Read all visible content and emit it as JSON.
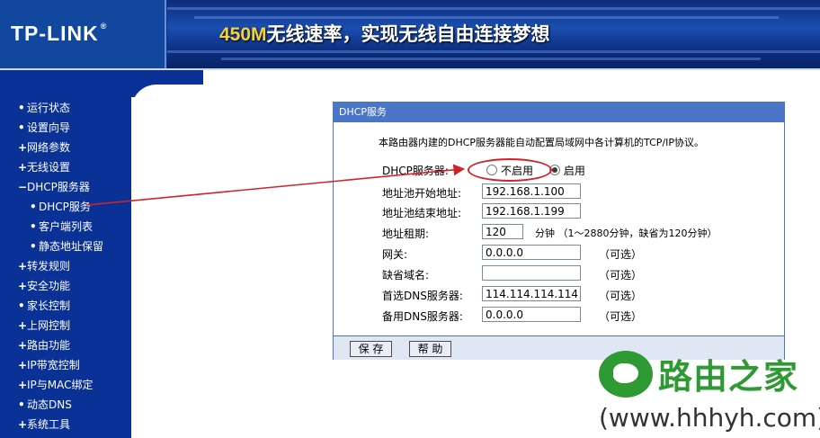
{
  "header": {
    "logo": "TP-LINK",
    "logo_reg": "®",
    "slogan_speed": "450M",
    "slogan_text": "无线速率，实现无线自由连接梦想"
  },
  "sidebar": {
    "items": [
      {
        "bullet": "•",
        "label": "运行状态"
      },
      {
        "bullet": "•",
        "label": "设置向导"
      },
      {
        "bullet": "+",
        "label": "网络参数"
      },
      {
        "bullet": "+",
        "label": "无线设置"
      },
      {
        "bullet": "−",
        "label": "DHCP服务器"
      },
      {
        "bullet": "•",
        "label": "DHCP服务"
      },
      {
        "bullet": "•",
        "label": "客户端列表"
      },
      {
        "bullet": "•",
        "label": "静态地址保留"
      },
      {
        "bullet": "+",
        "label": "转发规则"
      },
      {
        "bullet": "+",
        "label": "安全功能"
      },
      {
        "bullet": "•",
        "label": "家长控制"
      },
      {
        "bullet": "+",
        "label": "上网控制"
      },
      {
        "bullet": "+",
        "label": "路由功能"
      },
      {
        "bullet": "+",
        "label": "IP带宽控制"
      },
      {
        "bullet": "+",
        "label": "IP与MAC绑定"
      },
      {
        "bullet": "•",
        "label": "动态DNS"
      },
      {
        "bullet": "+",
        "label": "系统工具"
      }
    ]
  },
  "panel": {
    "title": "DHCP服务",
    "description": "本路由器内建的DHCP服务器能自动配置局域网中各计算机的TCP/IP协议。",
    "dhcp_server_label": "DHCP服务器:",
    "radio_disable": "不启用",
    "radio_enable": "启用",
    "selected": "启用",
    "fields": {
      "pool_start": {
        "label": "地址池开始地址:",
        "value": "192.168.1.100"
      },
      "pool_end": {
        "label": "地址池结束地址:",
        "value": "192.168.1.199"
      },
      "lease": {
        "label": "地址租期:",
        "value": "120",
        "note": "分钟 （1～2880分钟，缺省为120分钟）"
      },
      "gateway": {
        "label": "网关:",
        "value": "0.0.0.0",
        "note": "（可选）"
      },
      "domain": {
        "label": "缺省域名:",
        "value": "",
        "note": "（可选）"
      },
      "dns_primary": {
        "label": "首选DNS服务器:",
        "value": "114.114.114.114",
        "note": "（可选）"
      },
      "dns_secondary": {
        "label": "备用DNS服务器:",
        "value": "0.0.0.0",
        "note": "（可选）"
      }
    },
    "buttons": {
      "save": "保 存",
      "help": "帮 助"
    }
  },
  "watermark": {
    "brand": "路由之家",
    "url": "(www.hhhyh.com)"
  },
  "colors": {
    "nav_bg": "#0a3296",
    "panel_border": "#4b76c8",
    "annotation": "#d0232a",
    "watermark_green": "#2f9a34"
  }
}
